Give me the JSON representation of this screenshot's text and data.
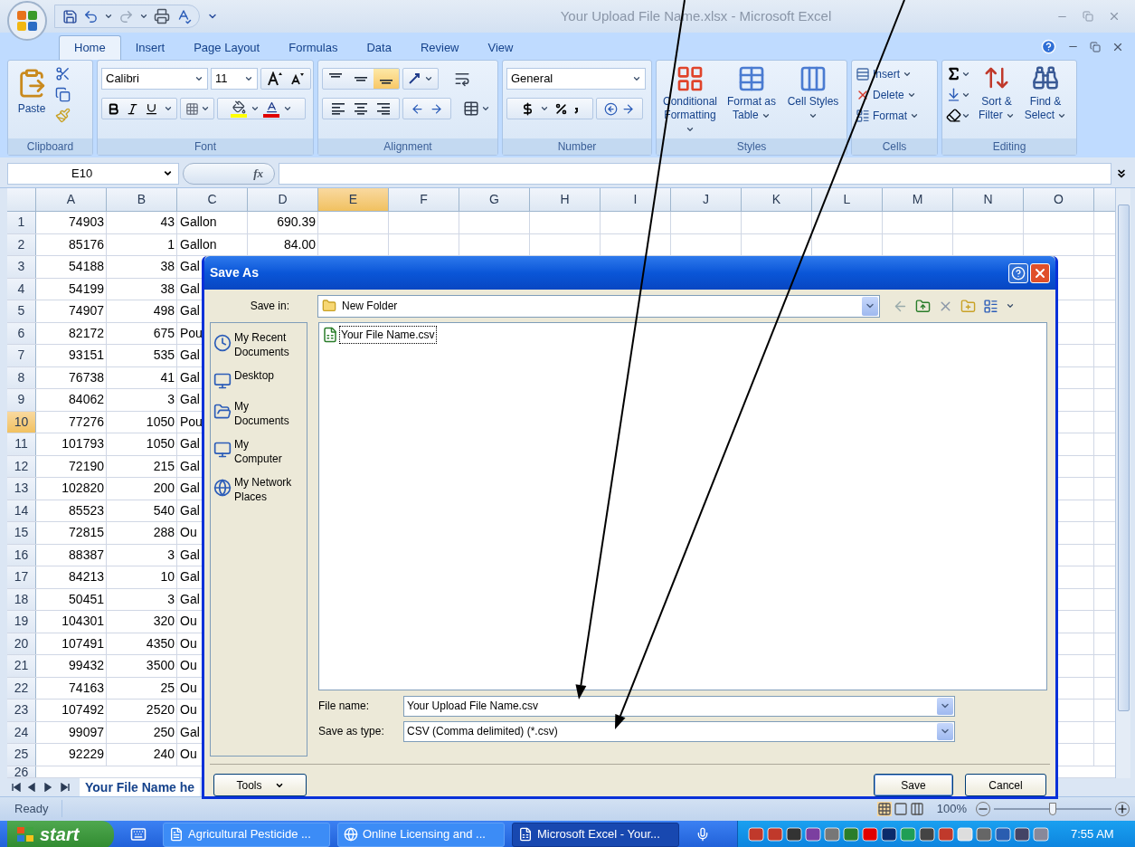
{
  "window": {
    "title": "Your Upload File Name.xlsx - Microsoft Excel"
  },
  "ribbon_tabs": [
    {
      "label": "Home",
      "selected": true
    },
    {
      "label": "Insert",
      "selected": false
    },
    {
      "label": "Page Layout",
      "selected": false
    },
    {
      "label": "Formulas",
      "selected": false
    },
    {
      "label": "Data",
      "selected": false
    },
    {
      "label": "Review",
      "selected": false
    },
    {
      "label": "View",
      "selected": false
    }
  ],
  "ribbon": {
    "clipboard": {
      "paste": "Paste",
      "label": "Clipboard"
    },
    "font": {
      "family": "Calibri",
      "size": "11",
      "label": "Font"
    },
    "alignment": {
      "vertical": [
        {
          "selected": false
        },
        {
          "selected": false
        },
        {
          "selected": true
        }
      ],
      "label": "Alignment"
    },
    "number": {
      "format": "General",
      "label": "Number"
    },
    "styles": {
      "buttons": [
        "Conditional Formatting",
        "Format as Table",
        "Cell Styles"
      ],
      "label": "Styles"
    },
    "cells": {
      "buttons": [
        "Insert",
        "Delete",
        "Format"
      ],
      "label": "Cells"
    },
    "editing": {
      "buttons": [
        "Sort & Filter",
        "Find & Select"
      ],
      "label": "Editing"
    }
  },
  "formula_bar": {
    "name_box": "E10",
    "function_label": "fx"
  },
  "columns": [
    {
      "label": "A",
      "selected": false
    },
    {
      "label": "B",
      "selected": false
    },
    {
      "label": "C",
      "selected": false
    },
    {
      "label": "D",
      "selected": false
    },
    {
      "label": "E",
      "selected": true
    },
    {
      "label": "F",
      "selected": false
    },
    {
      "label": "G",
      "selected": false
    },
    {
      "label": "H",
      "selected": false
    },
    {
      "label": "I",
      "selected": false
    },
    {
      "label": "J",
      "selected": false
    },
    {
      "label": "K",
      "selected": false
    },
    {
      "label": "L",
      "selected": false
    },
    {
      "label": "M",
      "selected": false
    },
    {
      "label": "N",
      "selected": false
    },
    {
      "label": "O",
      "selected": false
    }
  ],
  "rows": [
    {
      "number": "1",
      "selected": false,
      "cells": [
        "74903",
        "43",
        "Gallon",
        "690.39"
      ]
    },
    {
      "number": "2",
      "selected": false,
      "cells": [
        "85176",
        "1",
        "Gallon",
        "84.00"
      ]
    },
    {
      "number": "3",
      "selected": false,
      "cells": [
        "54188",
        "38",
        "Gal"
      ]
    },
    {
      "number": "4",
      "selected": false,
      "cells": [
        "54199",
        "38",
        "Gal"
      ]
    },
    {
      "number": "5",
      "selected": false,
      "cells": [
        "74907",
        "498",
        "Gal"
      ]
    },
    {
      "number": "6",
      "selected": false,
      "cells": [
        "82172",
        "675",
        "Pou"
      ]
    },
    {
      "number": "7",
      "selected": false,
      "cells": [
        "93151",
        "535",
        "Gal"
      ]
    },
    {
      "number": "8",
      "selected": false,
      "cells": [
        "76738",
        "41",
        "Gal"
      ]
    },
    {
      "number": "9",
      "selected": false,
      "cells": [
        "84062",
        "3",
        "Gal"
      ]
    },
    {
      "number": "10",
      "selected": true,
      "cells": [
        "77276",
        "1050",
        "Pou"
      ]
    },
    {
      "number": "11",
      "selected": false,
      "cells": [
        "101793",
        "1050",
        "Gal"
      ]
    },
    {
      "number": "12",
      "selected": false,
      "cells": [
        "72190",
        "215",
        "Gal"
      ]
    },
    {
      "number": "13",
      "selected": false,
      "cells": [
        "102820",
        "200",
        "Gal"
      ]
    },
    {
      "number": "14",
      "selected": false,
      "cells": [
        "85523",
        "540",
        "Gal"
      ]
    },
    {
      "number": "15",
      "selected": false,
      "cells": [
        "72815",
        "288",
        "Ou"
      ]
    },
    {
      "number": "16",
      "selected": false,
      "cells": [
        "88387",
        "3",
        "Gal"
      ]
    },
    {
      "number": "17",
      "selected": false,
      "cells": [
        "84213",
        "10",
        "Gal"
      ]
    },
    {
      "number": "18",
      "selected": false,
      "cells": [
        "50451",
        "3",
        "Gal"
      ]
    },
    {
      "number": "19",
      "selected": false,
      "cells": [
        "104301",
        "320",
        "Ou"
      ]
    },
    {
      "number": "20",
      "selected": false,
      "cells": [
        "107491",
        "4350",
        "Ou"
      ]
    },
    {
      "number": "21",
      "selected": false,
      "cells": [
        "99432",
        "3500",
        "Ou"
      ]
    },
    {
      "number": "22",
      "selected": false,
      "cells": [
        "74163",
        "25",
        "Ou"
      ]
    },
    {
      "number": "23",
      "selected": false,
      "cells": [
        "107492",
        "2520",
        "Ou"
      ]
    },
    {
      "number": "24",
      "selected": false,
      "cells": [
        "99097",
        "250",
        "Gal"
      ]
    },
    {
      "number": "25",
      "selected": false,
      "cells": [
        "92229",
        "240",
        "Ou"
      ]
    },
    {
      "number": "26",
      "selected": false,
      "cells": []
    }
  ],
  "sheet_tab": "Your File Name he",
  "status_bar": {
    "status": "Ready",
    "zoom": "100%",
    "zoom_slider": {
      "level": 0.5
    }
  },
  "dialog": {
    "title": "Save As",
    "save_in_label": "Save in:",
    "save_in": "New Folder",
    "places": [
      "My Recent Documents",
      "Desktop",
      "My Documents",
      "My Computer",
      "My Network Places"
    ],
    "files": [
      {
        "name": "Your File Name.csv",
        "selected": true
      }
    ],
    "file_name_label": "File name:",
    "file_name": "Your Upload File Name.csv",
    "type_label": "Save as type:",
    "type": "CSV (Comma delimited) (*.csv)",
    "tools": "Tools",
    "save": "Save",
    "cancel": "Cancel"
  },
  "taskbar": {
    "start": "start",
    "tasks": [
      {
        "label": "Agricultural Pesticide ...",
        "selected": false
      },
      {
        "label": "Online Licensing and ...",
        "selected": false
      },
      {
        "label": "Microsoft Excel - Your...",
        "selected": true
      }
    ],
    "clock": "7:55 AM"
  }
}
